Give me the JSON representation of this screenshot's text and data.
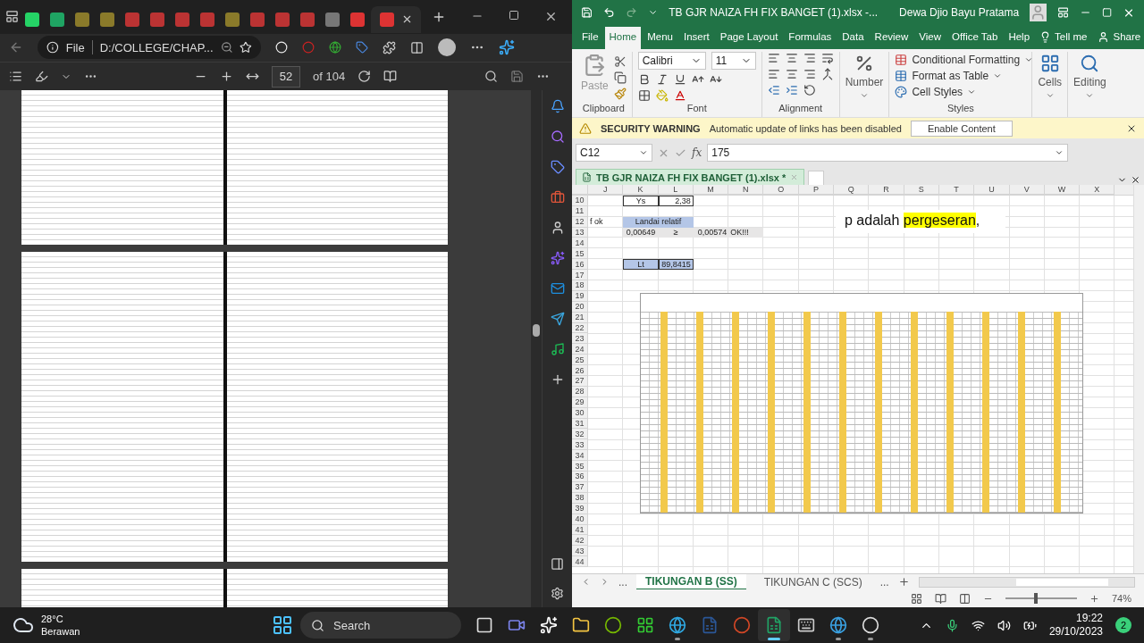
{
  "browser": {
    "tabs": [
      {
        "selected": false
      },
      {
        "selected": false
      },
      {
        "selected": false
      },
      {
        "selected": false
      },
      {
        "selected": false
      },
      {
        "selected": false
      },
      {
        "selected": false
      },
      {
        "selected": false
      },
      {
        "selected": false
      },
      {
        "selected": false
      },
      {
        "selected": false
      },
      {
        "selected": false
      },
      {
        "selected": false
      },
      {
        "selected": false
      },
      {
        "selected": true
      }
    ],
    "address": {
      "scheme": "File",
      "path": "D:/COLLEGE/CHAP..."
    },
    "pdf_toolbar": {
      "page": "52",
      "page_count": "of 104"
    }
  },
  "excel": {
    "title": "TB GJR NAIZA FH FIX BANGET (1).xlsx  -...",
    "user": "Dewa Djio Bayu Pratama",
    "ribbon_tabs": [
      {
        "label": "File",
        "selected": false
      },
      {
        "label": "Home",
        "selected": true
      },
      {
        "label": "Menu",
        "selected": false
      },
      {
        "label": "Insert",
        "selected": false
      },
      {
        "label": "Page Layout",
        "selected": false
      },
      {
        "label": "Formulas",
        "selected": false
      },
      {
        "label": "Data",
        "selected": false
      },
      {
        "label": "Review",
        "selected": false
      },
      {
        "label": "View",
        "selected": false
      },
      {
        "label": "Office Tab",
        "selected": false
      },
      {
        "label": "Help",
        "selected": false
      }
    ],
    "tell_me": "Tell me",
    "share": "Share",
    "ribbon": {
      "paste": "Paste",
      "font": "Calibri",
      "size": "11",
      "number": "Number",
      "styles": [
        "Conditional Formatting",
        "Format as Table",
        "Cell Styles"
      ],
      "cells": "Cells",
      "editing": "Editing",
      "groups": {
        "clipboard": "Clipboard",
        "font": "Font",
        "alignment": "Alignment",
        "styles": "Styles"
      }
    },
    "security": {
      "title": "SECURITY WARNING",
      "message": "Automatic update of links has been disabled",
      "button": "Enable Content"
    },
    "name_box": "C12",
    "fx_button": "fx",
    "formula": "175",
    "workbook_tab": "TB GJR NAIZA FH FIX BANGET (1).xlsx *",
    "columns": [
      "J",
      "K",
      "L",
      "M",
      "N",
      "O",
      "P",
      "Q",
      "R",
      "S",
      "T",
      "U",
      "V",
      "W",
      "X"
    ],
    "rows": [
      {
        "number": "10",
        "cells": [
          {
            "kind": "empty"
          },
          {
            "kind": "label",
            "text": "Ys",
            "border": true
          },
          {
            "kind": "number",
            "text": "2,38",
            "border": true
          }
        ]
      },
      {
        "number": "11"
      },
      {
        "number": "12",
        "cells": [
          {
            "kind": "text",
            "text": "f ok"
          },
          {
            "kind": "label",
            "text": "Landai relatif",
            "color": "#b4c6e7",
            "merged": true
          }
        ]
      },
      {
        "number": "13",
        "cells": [
          {
            "kind": "empty"
          },
          {
            "kind": "label",
            "text": "0,00649",
            "color": "#e7e6e6"
          },
          {
            "kind": "label",
            "text": "≥",
            "color": "#e7e6e6"
          },
          {
            "kind": "number",
            "text": "0,00574",
            "color": "#e7e6e6"
          },
          {
            "kind": "text",
            "text": "OK!!!",
            "color": "#e7e6e6"
          }
        ]
      },
      {
        "number": "14"
      },
      {
        "number": "15"
      },
      {
        "number": "16",
        "cells": [
          {
            "kind": "empty"
          },
          {
            "kind": "label",
            "text": "Lt",
            "color": "#b4c6e7",
            "border": true
          },
          {
            "kind": "number",
            "text": "89,8415",
            "color": "#b4c6e7",
            "border": true
          }
        ]
      },
      {
        "number": "17"
      },
      {
        "number": "18"
      },
      {
        "number": "19"
      },
      {
        "number": "20"
      },
      {
        "number": "21"
      },
      {
        "number": "22"
      },
      {
        "number": "23"
      },
      {
        "number": "24"
      },
      {
        "number": "25"
      },
      {
        "number": "26"
      },
      {
        "number": "27"
      },
      {
        "number": "28"
      },
      {
        "number": "29"
      },
      {
        "number": "30"
      },
      {
        "number": "31"
      },
      {
        "number": "32"
      },
      {
        "number": "33"
      },
      {
        "number": "34"
      },
      {
        "number": "35"
      },
      {
        "number": "36"
      },
      {
        "number": "37"
      },
      {
        "number": "38"
      },
      {
        "number": "39"
      },
      {
        "number": "40"
      },
      {
        "number": "41"
      },
      {
        "number": "42"
      },
      {
        "number": "43"
      },
      {
        "number": "44"
      }
    ],
    "text_box": [
      {
        "text": "p adalah "
      },
      {
        "text": "pergeseran",
        "highlight": true
      },
      {
        "text": ","
      }
    ],
    "sheet_nav_more": "...",
    "sheets": [
      {
        "label": "TIKUNGAN B (SS)",
        "selected": true
      },
      {
        "label": "TIKUNGAN C (SCS)",
        "selected": false
      }
    ],
    "sheet_more": "...",
    "zoom": {
      "level": 0.43,
      "reading": "74%"
    }
  },
  "taskbar": {
    "weather": {
      "temp": "28°C",
      "condition": "Berawan"
    },
    "search": "Search",
    "apps": [
      {
        "running": false,
        "selected": false
      },
      {
        "running": false,
        "selected": false
      },
      {
        "running": false,
        "selected": false
      },
      {
        "running": false,
        "selected": false
      },
      {
        "running": false,
        "selected": false
      },
      {
        "running": false,
        "selected": false
      },
      {
        "running": true,
        "selected": false
      },
      {
        "running": false,
        "selected": false
      },
      {
        "running": false,
        "selected": false
      },
      {
        "running": true,
        "selected": true
      },
      {
        "running": false,
        "selected": false
      },
      {
        "running": true,
        "selected": false
      },
      {
        "running": true,
        "selected": false
      }
    ],
    "time": "19:22",
    "date": "29/10/2023",
    "notifications": "2"
  }
}
